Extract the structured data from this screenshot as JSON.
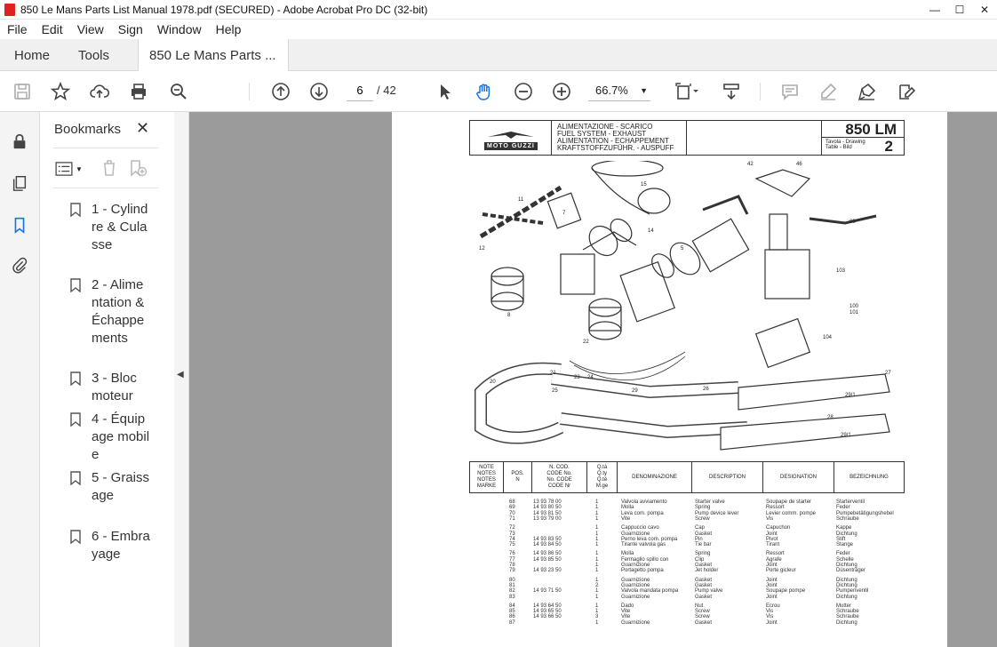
{
  "window": {
    "title": "850 Le Mans Parts List Manual 1978.pdf (SECURED) - Adobe Acrobat Pro DC (32-bit)",
    "minimize": "—",
    "maximize": "☐",
    "close": "✕"
  },
  "menu": [
    "File",
    "Edit",
    "View",
    "Sign",
    "Window",
    "Help"
  ],
  "tabs": {
    "home": "Home",
    "tools": "Tools",
    "document": "850 Le Mans Parts ..."
  },
  "toolbar": {
    "page_current": "6",
    "page_total": "/ 42",
    "zoom": "66.7%"
  },
  "bookmarks": {
    "title": "Bookmarks",
    "items": [
      {
        "label": "1 - Cylindre & Culasse"
      },
      {
        "label": "2 - Alimentation & Échappements"
      },
      {
        "label": "3 - Bloc moteur"
      },
      {
        "label": "4 - Équipage mobile"
      },
      {
        "label": "5 - Graissage"
      },
      {
        "label": "6 - Embrayage"
      }
    ]
  },
  "document": {
    "header_lines": [
      "ALIMENTAZIONE - SCARICO",
      "FUEL SYSTEM - EXHAUST",
      "ALIMENTATION - ECHAPPEMENT",
      "KRAFTSTOFFZUFÜHR. - AUSPUFF"
    ],
    "brand": "MOTO GUZZI",
    "model": "850 LM",
    "tavola": "Tavola - Drawing\nTable - Bild",
    "tavola_number": "2",
    "table_headers": {
      "note": "NOTE\nNOTES\nNOTES\nMARKE",
      "pos": "POS.\nN",
      "code": "N. COD.\nCODE No.\nNo. CODE\nCODE Nr",
      "qty": "Q.tà\nQ.ty\nQ.té\nM.ge",
      "denom": "DENOMINAZIONE",
      "desc": "DESCRIPTION",
      "design": "DESIGNATION",
      "bez": "BEZEICHNUNG"
    },
    "rows": [
      {
        "pos": "68",
        "code": "13 93 78 00",
        "qty": "1",
        "it": "Valvola avviamento",
        "en": "Starter valve",
        "fr": "Soupape de starter",
        "de": "Starterventil"
      },
      {
        "pos": "69",
        "code": "14 93 80 50",
        "qty": "1",
        "it": "Molla",
        "en": "Spring",
        "fr": "Ressort",
        "de": "Feder"
      },
      {
        "pos": "70",
        "code": "14 93 81 50",
        "qty": "1",
        "it": "Leva com. pompa",
        "en": "Pump device lever",
        "fr": "Levier comm. pompe",
        "de": "Pumpebetätigungshebel"
      },
      {
        "pos": "71",
        "code": "13 93 79 00",
        "qty": "1",
        "it": "Vite",
        "en": "Screw",
        "fr": "Vis",
        "de": "Schraube"
      },
      {
        "pos": "72",
        "code": "",
        "qty": "1",
        "it": "Cappuccio cavo",
        "en": "Cap",
        "fr": "Capuchon",
        "de": "Kappe"
      },
      {
        "pos": "73",
        "code": "",
        "qty": "1",
        "it": "Guarnizione",
        "en": "Gasket",
        "fr": "Joint",
        "de": "Dichtung"
      },
      {
        "pos": "74",
        "code": "14 93 83 50",
        "qty": "1",
        "it": "Perno leva com. pompa",
        "en": "Pin",
        "fr": "Pivot",
        "de": "Stift"
      },
      {
        "pos": "75",
        "code": "14 93 84 50",
        "qty": "1",
        "it": "Tirante valvola gas",
        "en": "Tie bar",
        "fr": "Tirant",
        "de": "Stange"
      },
      {
        "pos": "76",
        "code": "14 93 86 50",
        "qty": "1",
        "it": "Molla",
        "en": "Spring",
        "fr": "Ressort",
        "de": "Feder"
      },
      {
        "pos": "77",
        "code": "14 93 85 50",
        "qty": "1",
        "it": "Fermaglio spillo con",
        "en": "Clip",
        "fr": "Agrafe",
        "de": "Schelle"
      },
      {
        "pos": "78",
        "code": "",
        "qty": "1",
        "it": "Guarnizione",
        "en": "Gasket",
        "fr": "Joint",
        "de": "Dichtung"
      },
      {
        "pos": "79",
        "code": "14 93 23 50",
        "qty": "1",
        "it": "Portagetto pompa",
        "en": "Jet holder",
        "fr": "Porte gicleur",
        "de": "Düsenträger"
      },
      {
        "pos": "80",
        "code": "",
        "qty": "1",
        "it": "Guarnizione",
        "en": "Gasket",
        "fr": "Joint",
        "de": "Dichtung"
      },
      {
        "pos": "81",
        "code": "",
        "qty": "2",
        "it": "Guarnizione",
        "en": "Gasket",
        "fr": "Joint",
        "de": "Dichtung"
      },
      {
        "pos": "82",
        "code": "14 93 71 50",
        "qty": "1",
        "it": "Valvola mandata pompa",
        "en": "Pump valve",
        "fr": "Soupape pompe",
        "de": "Pumpenventil"
      },
      {
        "pos": "83",
        "code": "",
        "qty": "1",
        "it": "Guarnizione",
        "en": "Gasket",
        "fr": "Joint",
        "de": "Dichtung"
      },
      {
        "pos": "84",
        "code": "14 93 64 50",
        "qty": "1",
        "it": "Dado",
        "en": "Nut",
        "fr": "Ecrou",
        "de": "Mutter"
      },
      {
        "pos": "85",
        "code": "14 93 65 50",
        "qty": "1",
        "it": "Vite",
        "en": "Screw",
        "fr": "Vis",
        "de": "Schraube"
      },
      {
        "pos": "86",
        "code": "14 93 66 50",
        "qty": "3",
        "it": "Vite",
        "en": "Screw",
        "fr": "Vis",
        "de": "Schraube"
      },
      {
        "pos": "87",
        "code": "",
        "qty": "1",
        "it": "Guarnizione",
        "en": "Gasket",
        "fr": "Joint",
        "de": "Dichtung"
      }
    ]
  }
}
